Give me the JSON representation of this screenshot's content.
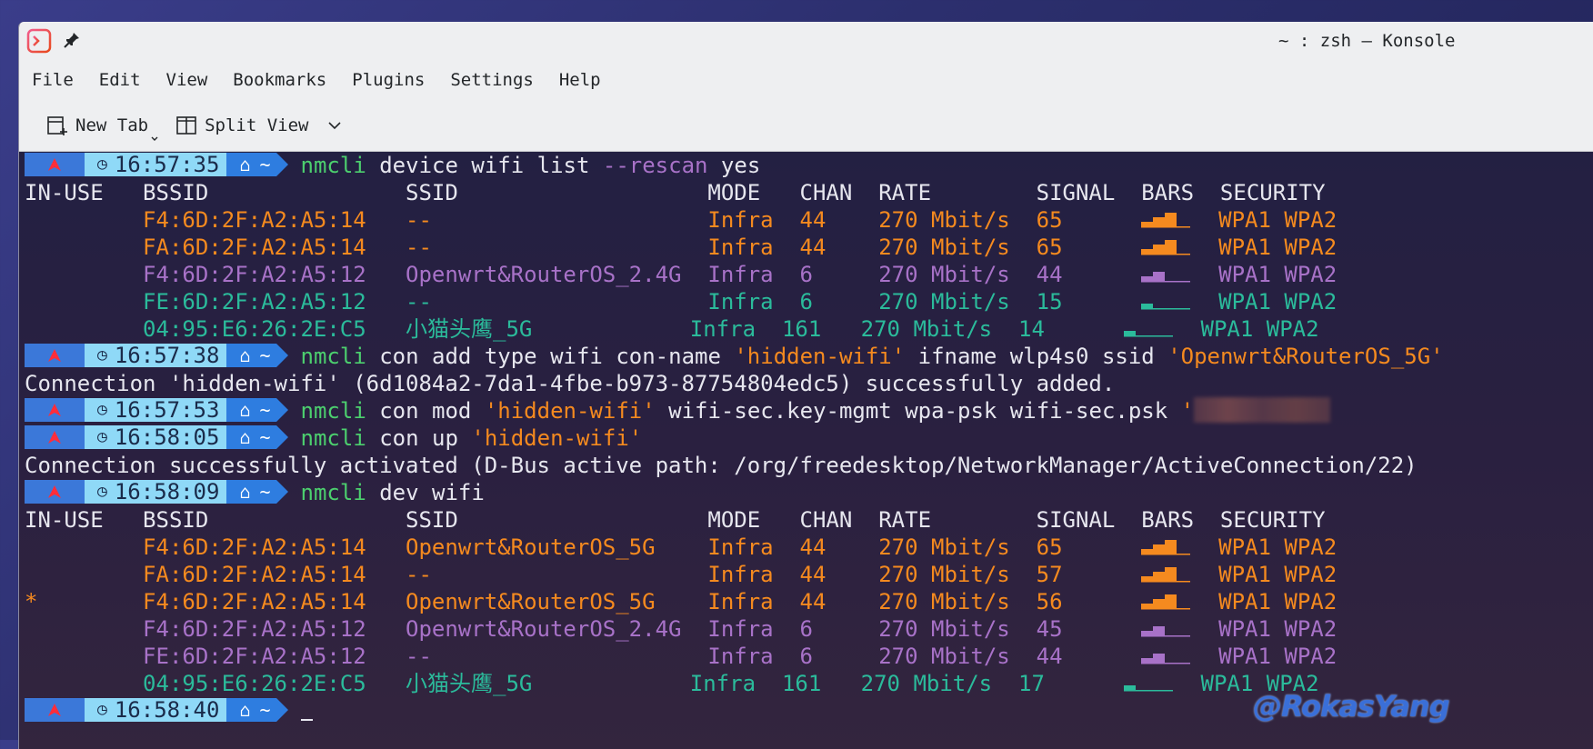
{
  "window": {
    "title": "~ : zsh — Konsole"
  },
  "menu": [
    "File",
    "Edit",
    "View",
    "Bookmarks",
    "Plugins",
    "Settings",
    "Help"
  ],
  "toolbar": {
    "new_tab": "New Tab",
    "split_view": "Split View"
  },
  "prompts": {
    "home_icon": "⌂",
    "clock_icon": "◷",
    "tilde": "~",
    "times": [
      "16:57:35",
      "16:57:38",
      "16:57:53",
      "16:58:05",
      "16:58:09",
      "16:58:40"
    ]
  },
  "colors": {
    "orange": "#f58a1f",
    "purple": "#a872c8",
    "teal": "#2bbb9b",
    "green": "#4ccf6e",
    "prompt_blue": "#2e7de0",
    "prompt_cyan": "#8fd9f7"
  },
  "commands": {
    "c1": {
      "bin": "nmcli",
      "args": " device wifi list ",
      "flag": "--rescan",
      "tail": " yes"
    },
    "c2": {
      "bin": "nmcli",
      "args": " con add type wifi con-name ",
      "q1": "'hidden-wifi'",
      "mid": " ifname wlp4s0 ssid ",
      "q2": "'Openwrt&RouterOS_5G'"
    },
    "c3": {
      "bin": "nmcli",
      "args": " con mod ",
      "q1": "'hidden-wifi'",
      "mid": " wifi-sec.key-mgmt wpa-psk wifi-sec.psk ",
      "q2": "'"
    },
    "c4": {
      "bin": "nmcli",
      "args": " con up ",
      "q1": "'hidden-wifi'"
    },
    "c5": {
      "bin": "nmcli",
      "args": " dev wifi"
    }
  },
  "outputs": {
    "added": "Connection 'hidden-wifi' (6d1084a2-7da1-4fbe-b973-87754804edc5) successfully added.",
    "activated": "Connection successfully activated (D-Bus active path: /org/freedesktop/NetworkManager/ActiveConnection/22)"
  },
  "table_header": {
    "in_use": "IN-USE",
    "bssid": "BSSID",
    "ssid": "SSID",
    "mode": "MODE",
    "chan": "CHAN",
    "rate": "RATE",
    "signal": "SIGNAL",
    "bars": "BARS",
    "security": "SECURITY"
  },
  "scan1": [
    {
      "in_use": "",
      "bssid": "F4:6D:2F:A2:A5:14",
      "ssid": "--",
      "mode": "Infra",
      "chan": "44",
      "rate": "270 Mbit/s",
      "signal": "65",
      "bars": 3,
      "security": "WPA1 WPA2",
      "color": "orange"
    },
    {
      "in_use": "",
      "bssid": "FA:6D:2F:A2:A5:14",
      "ssid": "--",
      "mode": "Infra",
      "chan": "44",
      "rate": "270 Mbit/s",
      "signal": "65",
      "bars": 3,
      "security": "WPA1 WPA2",
      "color": "orange"
    },
    {
      "in_use": "",
      "bssid": "F4:6D:2F:A2:A5:12",
      "ssid": "Openwrt&RouterOS_2.4G",
      "mode": "Infra",
      "chan": "6",
      "rate": "270 Mbit/s",
      "signal": "44",
      "bars": 2,
      "security": "WPA1 WPA2",
      "color": "purple"
    },
    {
      "in_use": "",
      "bssid": "FE:6D:2F:A2:A5:12",
      "ssid": "--",
      "mode": "Infra",
      "chan": "6",
      "rate": "270 Mbit/s",
      "signal": "15",
      "bars": 1,
      "security": "WPA1 WPA2",
      "color": "teal"
    },
    {
      "in_use": "",
      "bssid": "04:95:E6:26:2E:C5",
      "ssid": "小猫头鹰_5G",
      "mode": "Infra",
      "chan": "161",
      "rate": "270 Mbit/s",
      "signal": "14",
      "bars": 1,
      "security": "WPA1 WPA2",
      "color": "teal"
    }
  ],
  "scan2": [
    {
      "in_use": "",
      "bssid": "F4:6D:2F:A2:A5:14",
      "ssid": "Openwrt&RouterOS_5G",
      "mode": "Infra",
      "chan": "44",
      "rate": "270 Mbit/s",
      "signal": "65",
      "bars": 3,
      "security": "WPA1 WPA2",
      "color": "orange"
    },
    {
      "in_use": "",
      "bssid": "FA:6D:2F:A2:A5:14",
      "ssid": "--",
      "mode": "Infra",
      "chan": "44",
      "rate": "270 Mbit/s",
      "signal": "57",
      "bars": 3,
      "security": "WPA1 WPA2",
      "color": "orange"
    },
    {
      "in_use": "*",
      "bssid": "F4:6D:2F:A2:A5:14",
      "ssid": "Openwrt&RouterOS_5G",
      "mode": "Infra",
      "chan": "44",
      "rate": "270 Mbit/s",
      "signal": "56",
      "bars": 3,
      "security": "WPA1 WPA2",
      "color": "orange"
    },
    {
      "in_use": "",
      "bssid": "F4:6D:2F:A2:A5:12",
      "ssid": "Openwrt&RouterOS_2.4G",
      "mode": "Infra",
      "chan": "6",
      "rate": "270 Mbit/s",
      "signal": "45",
      "bars": 2,
      "security": "WPA1 WPA2",
      "color": "purple"
    },
    {
      "in_use": "",
      "bssid": "FE:6D:2F:A2:A5:12",
      "ssid": "--",
      "mode": "Infra",
      "chan": "6",
      "rate": "270 Mbit/s",
      "signal": "44",
      "bars": 2,
      "security": "WPA1 WPA2",
      "color": "purple"
    },
    {
      "in_use": "",
      "bssid": "04:95:E6:26:2E:C5",
      "ssid": "小猫头鹰_5G",
      "mode": "Infra",
      "chan": "161",
      "rate": "270 Mbit/s",
      "signal": "17",
      "bars": 1,
      "security": "WPA1 WPA2",
      "color": "teal"
    }
  ],
  "watermark": "@RokasYang"
}
